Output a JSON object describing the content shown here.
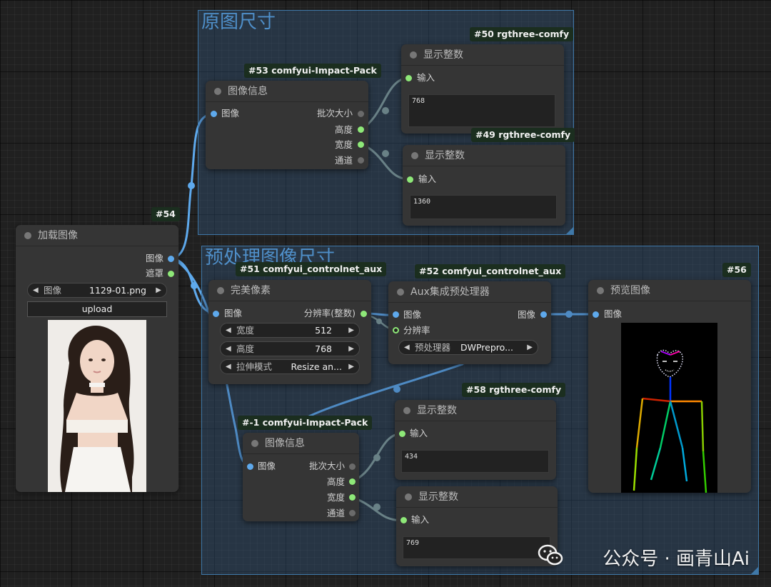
{
  "groups": {
    "original_size": {
      "title": "原图尺寸"
    },
    "preprocess_size": {
      "title": "预处理图像尺寸"
    }
  },
  "nodes": {
    "n54": {
      "badge": "#54",
      "title": "加载图像",
      "outputs": [
        "图像",
        "遮罩"
      ],
      "image_widget": {
        "label": "图像",
        "value": "1129-01.png"
      },
      "upload_label": "upload"
    },
    "n53": {
      "badge": "#53 comfyui-Impact-Pack",
      "title": "图像信息",
      "input": "图像",
      "outputs": [
        "批次大小",
        "高度",
        "宽度",
        "通道"
      ]
    },
    "n50": {
      "badge": "#50 rgthree-comfy",
      "title": "显示整数",
      "input": "输入",
      "value": "768"
    },
    "n49": {
      "badge": "#49 rgthree-comfy",
      "title": "显示整数",
      "input": "输入",
      "value": "1360"
    },
    "n51": {
      "badge": "#51 comfyui_controlnet_aux",
      "title": "完美像素",
      "input": "图像",
      "output": "分辨率(整数)",
      "widgets": [
        {
          "label": "宽度",
          "value": "512"
        },
        {
          "label": "高度",
          "value": "768"
        },
        {
          "label": "拉伸模式",
          "value": "Resize an..."
        }
      ]
    },
    "n52": {
      "badge": "#52 comfyui_controlnet_aux",
      "title": "Aux集成预处理器",
      "inputs": [
        "图像",
        "分辨率"
      ],
      "output": "图像",
      "widget": {
        "label": "预处理器",
        "value": "DWPrepro..."
      }
    },
    "n56": {
      "badge": "#56",
      "title": "预览图像",
      "input": "图像"
    },
    "n_1": {
      "badge": "#-1 comfyui-Impact-Pack",
      "title": "图像信息",
      "input": "图像",
      "outputs": [
        "批次大小",
        "高度",
        "宽度",
        "通道"
      ]
    },
    "n58": {
      "badge": "#58 rgthree-comfy",
      "title": "显示整数",
      "input": "输入",
      "value": "434"
    },
    "n59": {
      "title": "显示整数",
      "input": "输入",
      "value": "769"
    }
  },
  "watermark": {
    "text": "公众号 · 画青山Ai"
  },
  "colors": {
    "image_link": "#5ea9ec",
    "int_link": "#8a9a8a",
    "group_fill": "#345a80",
    "node_bg": "#353535",
    "badge_bg": "#1b2e1f"
  }
}
